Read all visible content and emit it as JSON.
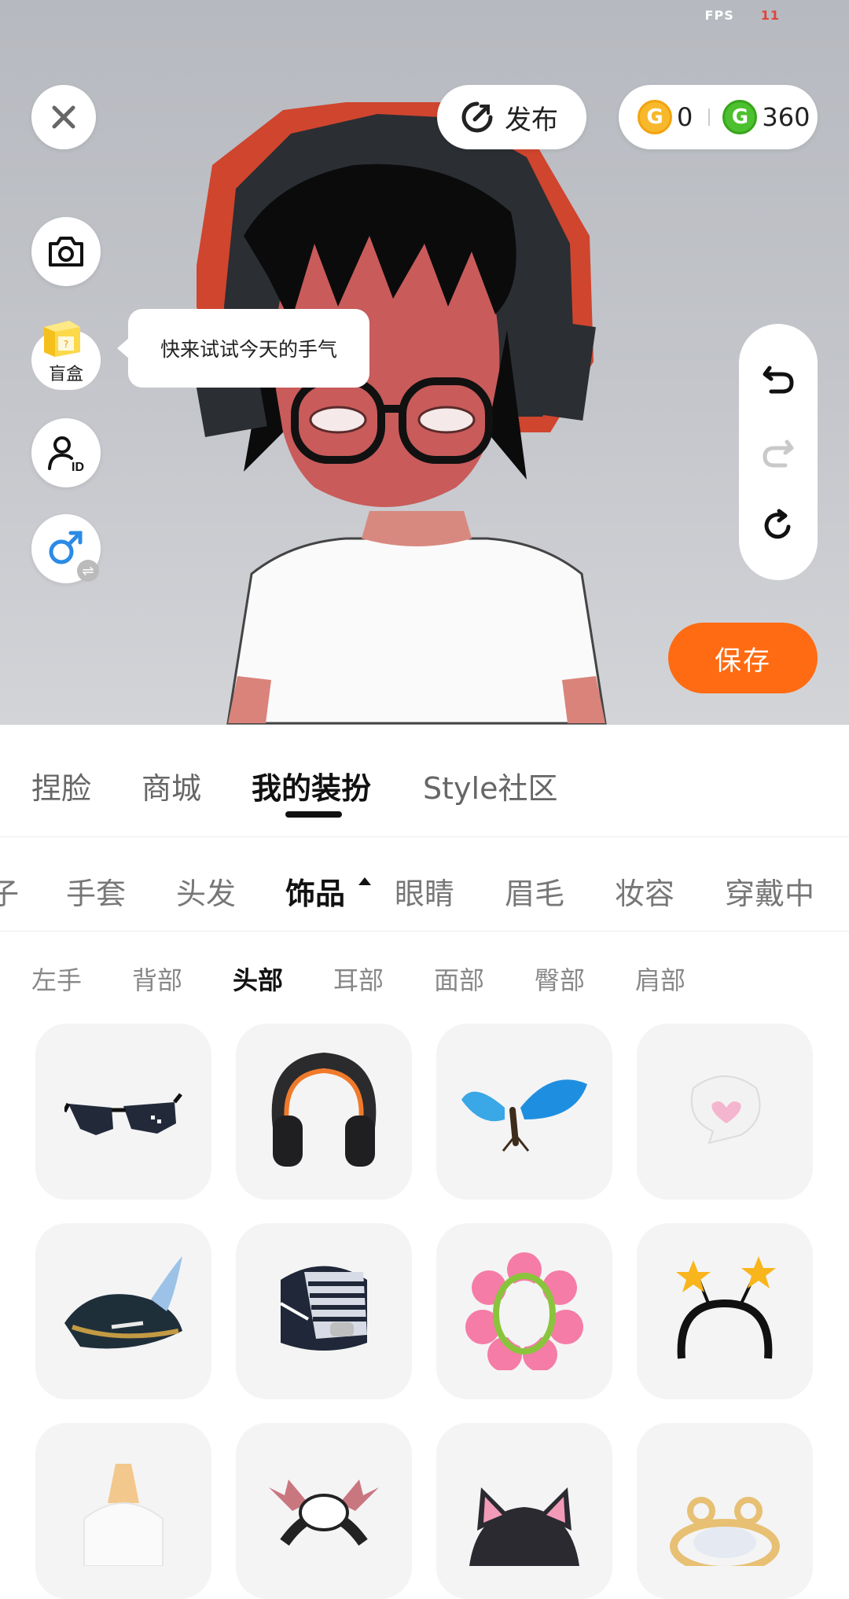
{
  "fps": {
    "label": "FPS",
    "value": "11"
  },
  "top": {
    "publish_label": "发布",
    "gold_coins": "0",
    "green_coins": "360"
  },
  "side": {
    "blind_box_label": "盲盒",
    "tooltip": "快来试试今天的手气"
  },
  "save_label": "保存",
  "tabs": [
    "捏脸",
    "商城",
    "我的装扮",
    "Style社区"
  ],
  "active_tab": "我的装扮",
  "categories": [
    "子",
    "手套",
    "头发",
    "饰品",
    "眼睛",
    "眉毛",
    "妆容",
    "穿戴中"
  ],
  "active_category": "饰品",
  "subcategories": [
    "左手",
    "背部",
    "头部",
    "耳部",
    "面部",
    "臀部",
    "肩部"
  ],
  "active_subcategory": "头部",
  "items": [
    {
      "icon": "sunglasses-icon"
    },
    {
      "icon": "headphones-icon"
    },
    {
      "icon": "butterfly-icon"
    },
    {
      "icon": "speech-bubble-heart-icon"
    },
    {
      "icon": "pirate-hat-icon"
    },
    {
      "icon": "striped-hood-icon"
    },
    {
      "icon": "flower-halo-icon"
    },
    {
      "icon": "star-headband-icon"
    },
    {
      "icon": "unicorn-horn-icon"
    },
    {
      "icon": "bat-wings-icon"
    },
    {
      "icon": "cat-ears-icon"
    },
    {
      "icon": "golden-crown-icon"
    }
  ],
  "colors": {
    "accent": "#ff6b12",
    "gold": "#f7b92b",
    "green": "#4cc02e"
  }
}
